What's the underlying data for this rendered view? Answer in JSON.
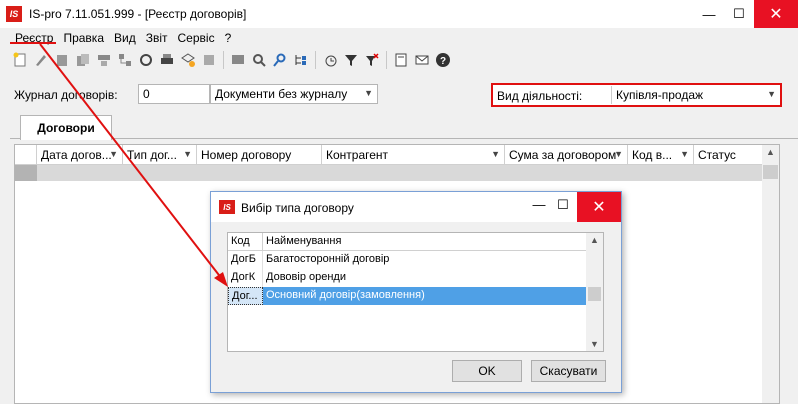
{
  "window": {
    "logo": "IS",
    "title": "IS-pro 7.11.051.999 - [Реєстр договорів]",
    "minimize": "—",
    "maximize": "☐",
    "close": "✕"
  },
  "menu": {
    "items": [
      "Реєстр",
      "Правка",
      "Вид",
      "Звіт",
      "Сервіс",
      "?"
    ]
  },
  "toolbar": {
    "icons": [
      "new-doc-icon",
      "edit-icon",
      "delete-icon",
      "copy-icon",
      "move-icon",
      "tree-icon",
      "refresh-icon",
      "print-icon",
      "export-icon",
      "import-icon",
      "view-icon",
      "search-icon",
      "find-next-icon",
      "tree-expand-icon",
      "calc-icon",
      "filter-icon",
      "clear-filter-icon",
      "notes-icon",
      "mail-icon",
      "help-icon"
    ]
  },
  "filters": {
    "journal_label": "Журнал договорів:",
    "journal_code": "0",
    "journal_name": "Документи без журналу",
    "activity_label": "Вид діяльності:",
    "activity_value": "Купівля-продаж"
  },
  "tabs": {
    "active": "Договори"
  },
  "grid": {
    "columns": [
      "Дата догов...",
      "Тип дог...",
      "Номер договору",
      "Контрагент",
      "Сума за договором",
      "Код в...",
      "Статус"
    ]
  },
  "dialog": {
    "logo": "IS",
    "title": "Вибір типа договору",
    "minimize": "—",
    "maximize": "☐",
    "close": "✕",
    "columns": [
      "Код",
      "Найменування"
    ],
    "rows": [
      {
        "code": "ДогБ",
        "name": "Багатосторонній договір"
      },
      {
        "code": "ДогК",
        "name": "Дововір оренди"
      },
      {
        "code": "Дог...",
        "name": "Основний договір(замовлення)"
      }
    ],
    "ok_label": "OK",
    "cancel_label": "Скасувати"
  },
  "colors": {
    "annotation": "#e01010",
    "selection": "#4fa0e6",
    "close_button": "#e81123"
  }
}
